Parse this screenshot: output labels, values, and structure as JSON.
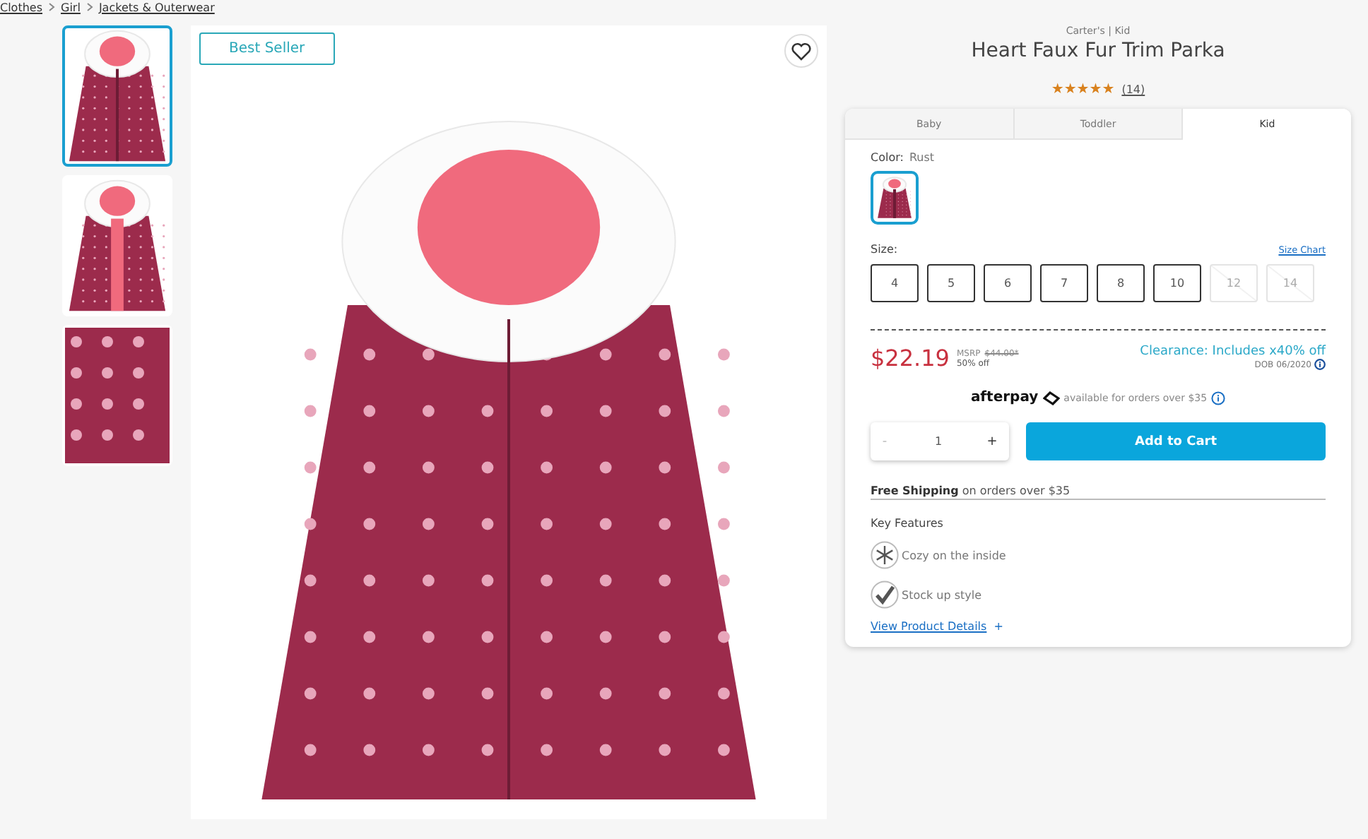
{
  "breadcrumbs": [
    "Clothes",
    "Girl",
    "Jackets & Outerwear"
  ],
  "thumbnails": [
    {
      "kind": "front",
      "selected": true
    },
    {
      "kind": "open",
      "selected": false
    },
    {
      "kind": "fabric",
      "selected": false
    }
  ],
  "badge": "Best Seller",
  "product": {
    "brand": "Carter's | Kid",
    "title": "Heart Faux Fur Trim Parka",
    "stars": 5,
    "review_count": "(14)"
  },
  "tabs": [
    {
      "label": "Baby",
      "selected": false
    },
    {
      "label": "Toddler",
      "selected": false
    },
    {
      "label": "Kid",
      "selected": true
    }
  ],
  "color": {
    "label": "Color:",
    "value": "Rust",
    "swatches": [
      {
        "selected": true
      }
    ]
  },
  "size": {
    "label": "Size:",
    "chart_link": "Size Chart",
    "options": [
      {
        "label": "4",
        "disabled": false
      },
      {
        "label": "5",
        "disabled": false
      },
      {
        "label": "6",
        "disabled": false
      },
      {
        "label": "7",
        "disabled": false
      },
      {
        "label": "8",
        "disabled": false
      },
      {
        "label": "10",
        "disabled": false
      },
      {
        "label": "12",
        "disabled": true
      },
      {
        "label": "14",
        "disabled": true
      }
    ]
  },
  "price": {
    "sale": "$22.19",
    "msrp_label": "MSRP",
    "msrp": "$44.00*",
    "discount": "50% off",
    "clearance": "Clearance: Includes x40% off",
    "dob": "DOB 06/2020"
  },
  "afterpay": {
    "logo": "afterpay",
    "note": "available for orders over $35"
  },
  "quantity": {
    "minus": "-",
    "value": "1",
    "plus": "+"
  },
  "add_to_cart": "Add to Cart",
  "shipping": "**Free Shipping** on orders over $35",
  "key_features": {
    "title": "Key Features",
    "items": [
      {
        "kind": "snowflake",
        "label": "Cozy on the inside"
      },
      {
        "kind": "check",
        "label": "Stock up style"
      }
    ]
  },
  "details_link": {
    "label": "View Product Details",
    "icon": "+"
  }
}
